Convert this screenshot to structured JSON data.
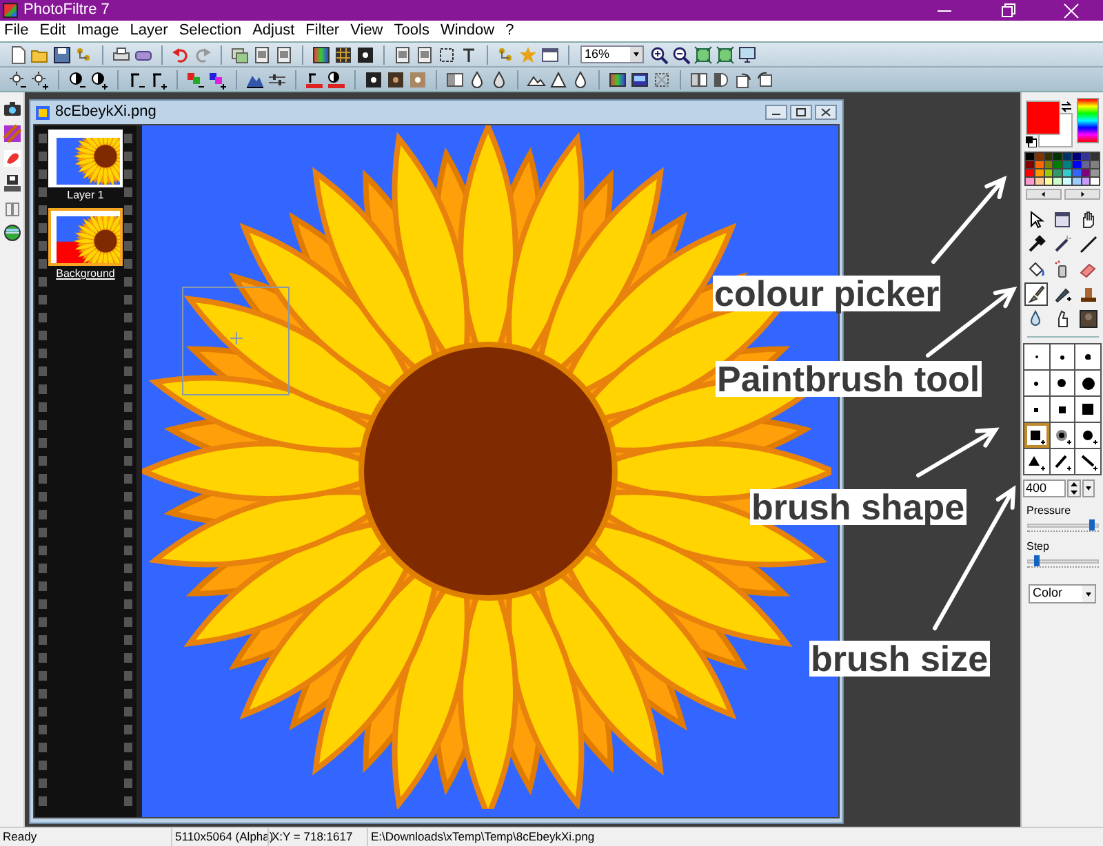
{
  "window": {
    "title": "PhotoFiltre 7"
  },
  "menu": [
    "File",
    "Edit",
    "Image",
    "Layer",
    "Selection",
    "Adjust",
    "Filter",
    "View",
    "Tools",
    "Window",
    "?"
  ],
  "zoom_combo": {
    "value": "16%"
  },
  "document": {
    "title": "8cEbeykXi.png"
  },
  "layers": [
    {
      "label": "Layer 1",
      "kind": "sunflower",
      "selected": false
    },
    {
      "label": "Background",
      "kind": "background",
      "selected": true
    }
  ],
  "color_swatches": [
    {
      "kind": "background",
      "color": "#ffffff"
    },
    {
      "kind": "foreground",
      "color": "#ff0000"
    }
  ],
  "palette": [
    {
      "color": "#000000"
    },
    {
      "color": "#803300"
    },
    {
      "color": "#333300"
    },
    {
      "color": "#003300"
    },
    {
      "color": "#003366"
    },
    {
      "color": "#000080"
    },
    {
      "color": "#333399"
    },
    {
      "color": "#333333"
    },
    {
      "color": "#800000"
    },
    {
      "color": "#ff6600"
    },
    {
      "color": "#808000"
    },
    {
      "color": "#008000"
    },
    {
      "color": "#008080"
    },
    {
      "color": "#0000ff"
    },
    {
      "color": "#666699"
    },
    {
      "color": "#808080"
    },
    {
      "color": "#ff0000"
    },
    {
      "color": "#ff9900"
    },
    {
      "color": "#99cc00"
    },
    {
      "color": "#339966"
    },
    {
      "color": "#33cccc"
    },
    {
      "color": "#3366ff"
    },
    {
      "color": "#800080"
    },
    {
      "color": "#969696"
    },
    {
      "color": "#ff99cc"
    },
    {
      "color": "#ffcc99"
    },
    {
      "color": "#ffff99"
    },
    {
      "color": "#ccffcc"
    },
    {
      "color": "#ccffff"
    },
    {
      "color": "#99ccff"
    },
    {
      "color": "#cc99ff"
    },
    {
      "color": "#ffffff"
    }
  ],
  "tools": [
    {
      "selected": false
    },
    {
      "selected": false
    },
    {
      "selected": false
    },
    {
      "selected": false
    },
    {
      "selected": false
    },
    {
      "selected": false
    },
    {
      "selected": false
    },
    {
      "selected": false
    },
    {
      "selected": false
    },
    {
      "selected": true
    },
    {
      "selected": false
    },
    {
      "selected": false
    },
    {
      "selected": false
    },
    {
      "selected": false
    },
    {
      "selected": false
    }
  ],
  "brush_shapes": [
    {
      "kind": "round",
      "selected": false
    },
    {
      "kind": "round",
      "selected": false
    },
    {
      "kind": "round",
      "selected": false
    },
    {
      "kind": "round",
      "selected": false
    },
    {
      "kind": "round",
      "selected": false
    },
    {
      "kind": "round",
      "selected": false
    },
    {
      "kind": "square",
      "selected": false
    },
    {
      "kind": "square",
      "selected": false
    },
    {
      "kind": "square",
      "selected": false
    },
    {
      "kind": "square",
      "selected": true
    },
    {
      "kind": "soft",
      "selected": false
    },
    {
      "kind": "round",
      "selected": false
    },
    {
      "kind": "triangle",
      "selected": false
    },
    {
      "kind": "slash",
      "selected": false
    },
    {
      "kind": "backslash",
      "selected": false
    }
  ],
  "brush_size": {
    "value": "400"
  },
  "pressure": {
    "label": "Pressure",
    "level": 0.95
  },
  "step": {
    "label": "Step",
    "level": 0.12
  },
  "mode_dropdown": {
    "value": "Color"
  },
  "annotations": [
    {
      "text": "colour picker"
    },
    {
      "text": "Paintbrush tool"
    },
    {
      "text": "brush shape"
    },
    {
      "text": "brush size"
    }
  ],
  "status_bar": [
    "Ready",
    "5110x5064 (Alpha)",
    "X:Y = 718:1617",
    "E:\\Downloads\\xTemp\\Temp\\8cEbeykXi.png"
  ]
}
